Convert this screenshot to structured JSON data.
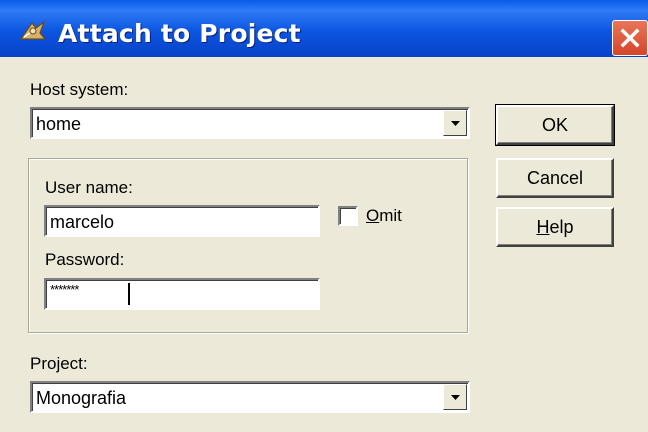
{
  "window": {
    "title": "Attach to Project",
    "icons": {
      "app": "wizard-app-icon",
      "close": "close-icon"
    },
    "colors": {
      "titlebar": "#0c55e0",
      "close": "#d4462a",
      "face": "#ece9d8"
    }
  },
  "host": {
    "label": "Host system:",
    "value": "home"
  },
  "credentials": {
    "user_label": "User name:",
    "user_value": "marcelo",
    "omit_mnemonic": "O",
    "omit_rest": "mit",
    "omit_checked": false,
    "password_label": "Password:",
    "password_value": "*******"
  },
  "project": {
    "label": "Project:",
    "value": "Monografia"
  },
  "buttons": {
    "ok": "OK",
    "cancel": "Cancel",
    "help_mnemonic": "H",
    "help_rest": "elp"
  }
}
